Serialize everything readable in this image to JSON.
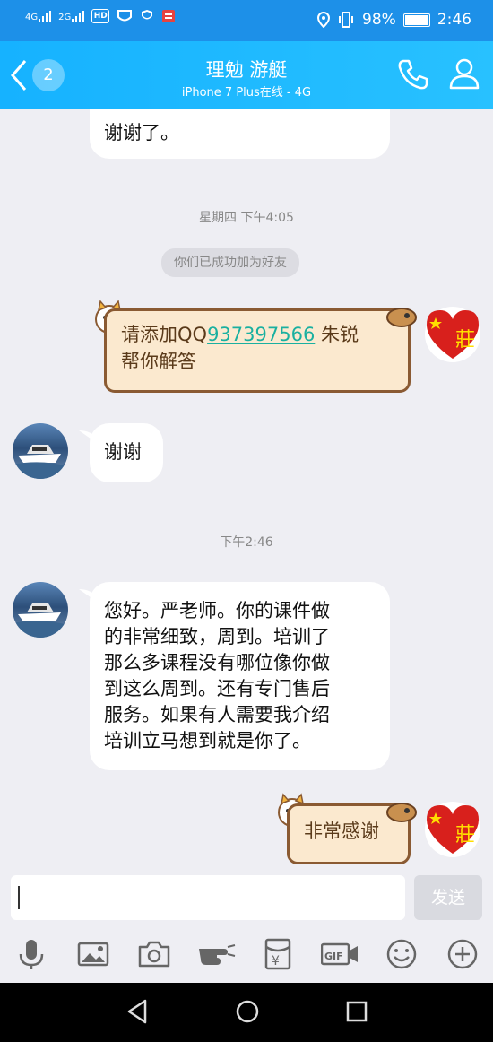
{
  "status_bar": {
    "net_1": "4G",
    "net_2": "2G",
    "hd": "HD",
    "battery_text": "98%",
    "time": "2:46"
  },
  "header": {
    "back_count": "2",
    "title": "理勉 游艇",
    "subtitle": "iPhone 7 Plus在线 - 4G"
  },
  "messages": {
    "partial_top": "谢谢了。",
    "timestamp_1": "星期四 下午4:05",
    "system_notice": "你们已成功加为好友",
    "sent_1_pre": "请添加QQ",
    "sent_1_link": "937397566",
    "sent_1_post": " 朱锐",
    "sent_1_line2": "帮你解答",
    "recv_1": "谢谢",
    "timestamp_2": "下午2:46",
    "recv_2_lines": [
      "您好。严老师。你的课件做",
      "的非常细致，周到。培训了",
      "那么多课程没有哪位像你做",
      "到这么周到。还有专门售后",
      "服务。如果有人需要我介绍",
      "培训立马想到就是你了。"
    ],
    "sent_2": "非常感谢"
  },
  "input": {
    "value": "",
    "send_label": "发送"
  },
  "toolbar": {
    "icons": [
      "microphone-icon",
      "image-icon",
      "camera-icon",
      "poke-icon",
      "red-packet-icon",
      "gif-icon",
      "emoji-icon",
      "plus-icon"
    ]
  },
  "colors": {
    "status_bar": "#1d90e8",
    "header": "#16b2ff",
    "background": "#eeeef3",
    "cat_bubble": "#fbe9cf",
    "link": "#1ab0a0"
  }
}
